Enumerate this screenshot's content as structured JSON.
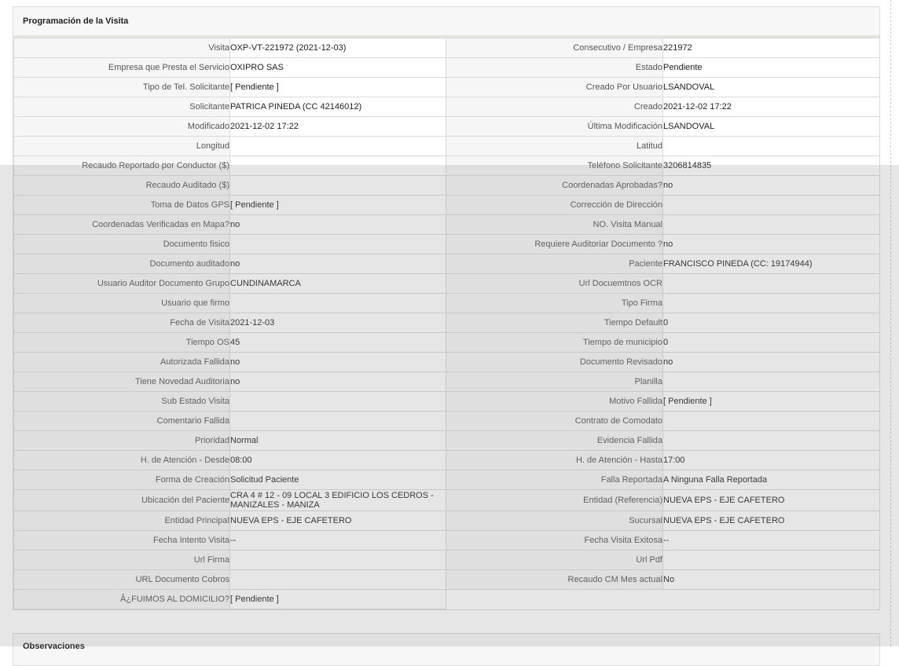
{
  "panel": {
    "title": "Programación de la Visita",
    "rows": [
      {
        "l1": "Visita",
        "v1": "OXP-VT-221972 (2021-12-03)",
        "l2": "Consecutivo / Empresa",
        "v2": "221972"
      },
      {
        "l1": "Empresa que Presta el Servicio",
        "v1": "OXIPRO SAS",
        "l2": "Estado",
        "v2": "Pendiente"
      },
      {
        "l1": "Tipo de Tel. Solicitante",
        "v1": "[ Pendiente ]",
        "l2": "Creado Por Usuario",
        "v2": "LSANDOVAL"
      },
      {
        "l1": "Solicitante",
        "v1": "PATRICA PINEDA (CC 42146012)",
        "l2": "Creado",
        "v2": "2021-12-02 17:22"
      },
      {
        "l1": "Modificado",
        "v1": "2021-12-02 17:22",
        "l2": "Última Modificación",
        "v2": " LSANDOVAL"
      },
      {
        "l1": "Longitud",
        "v1": "",
        "l2": "Latitud",
        "v2": ""
      },
      {
        "l1": "Recaudo Reportado por Conductor ($)",
        "v1": "",
        "l2": "Teléfono Solicitante",
        "v2": "3206814835"
      },
      {
        "l1": "Recaudo Auditado ($)",
        "v1": "",
        "l2": "Coordenadas Aprobadas?",
        "v2": " no"
      },
      {
        "l1": "Toma de Datos GPS",
        "v1": "[ Pendiente ]",
        "l2": "Corrección de Dirección",
        "v2": ""
      },
      {
        "l1": "Coordenadas Verificadas en Mapa?",
        "v1": " no",
        "l2": "NO. Visita Manual",
        "v2": ""
      },
      {
        "l1": "Documento fisico",
        "v1": "",
        "l2": "Requiere Auditoriar Documento ?",
        "v2": " no"
      },
      {
        "l1": "Documento auditado",
        "v1": " no",
        "l2": "Paciente",
        "v2": "FRANCISCO PINEDA (CC: 19174944)"
      },
      {
        "l1": "Usuario Auditor Documento Grupo",
        "v1": "CUNDINAMARCA",
        "l2": "Url Docuemtnos OCR",
        "v2": ""
      },
      {
        "l1": "Usuario que firmo",
        "v1": "",
        "l2": "Tipo Firma",
        "v2": ""
      },
      {
        "l1": "Fecha de Visita",
        "v1": " 2021-12-03",
        "l2": "Tiempo Default",
        "v2": "0"
      },
      {
        "l1": "Tiempo OS",
        "v1": "45",
        "l2": "Tiempo de municipio",
        "v2": "0"
      },
      {
        "l1": "Autorizada Fallida",
        "v1": " no",
        "l2": "Documento Revisado",
        "v2": " no"
      },
      {
        "l1": "Tiene Novedad Auditoria",
        "v1": " no",
        "l2": "Planilla",
        "v2": ""
      },
      {
        "l1": "Sub Estado Visita",
        "v1": "",
        "l2": "Motivo Fallida",
        "v2": "[ Pendiente ]"
      },
      {
        "l1": "Comentario Fallida",
        "v1": "",
        "l2": "Contrato de Comodato",
        "v2": ""
      },
      {
        "l1": "Prioridad",
        "v1": "Normal",
        "l2": "Evidencia Fallida",
        "v2": ""
      },
      {
        "l1": "H. de Atención - Desde",
        "v1": "08:00",
        "l2": "H. de Atención - Hasta",
        "v2": "17:00"
      },
      {
        "l1": "Forma de Creación",
        "v1": "Solicitud Paciente",
        "l2": "Falla Reportada",
        "v2": "A Ninguna Falla Reportada"
      },
      {
        "l1": "Ubicación del Paciente",
        "v1": "CRA 4 # 12 - 09 LOCAL 3 EDIFICIO LOS CEDROS - MANIZALES - MANIZA",
        "l2": "Entidad (Referencia)",
        "v2": "NUEVA EPS - EJE CAFETERO"
      },
      {
        "l1": "Entidad Principal",
        "v1": "NUEVA EPS - EJE CAFETERO",
        "l2": "Sucursal",
        "v2": "NUEVA EPS - EJE CAFETERO"
      },
      {
        "l1": "Fecha Intento Visita",
        "v1": " --",
        "l2": "Fecha Visita Exitosa",
        "v2": " --"
      },
      {
        "l1": "Url Firma",
        "v1": "",
        "l2": "Url Pdf",
        "v2": ""
      },
      {
        "l1": "URL Documento Cobros",
        "v1": "",
        "l2": "Recaudo CM Mes actual",
        "v2": "No"
      }
    ],
    "last_row": {
      "l1": "Â¿FUIMOS AL DOMICILIO?",
      "v1": "[ Pendiente ]"
    }
  },
  "panel2": {
    "title": "Observaciones"
  }
}
